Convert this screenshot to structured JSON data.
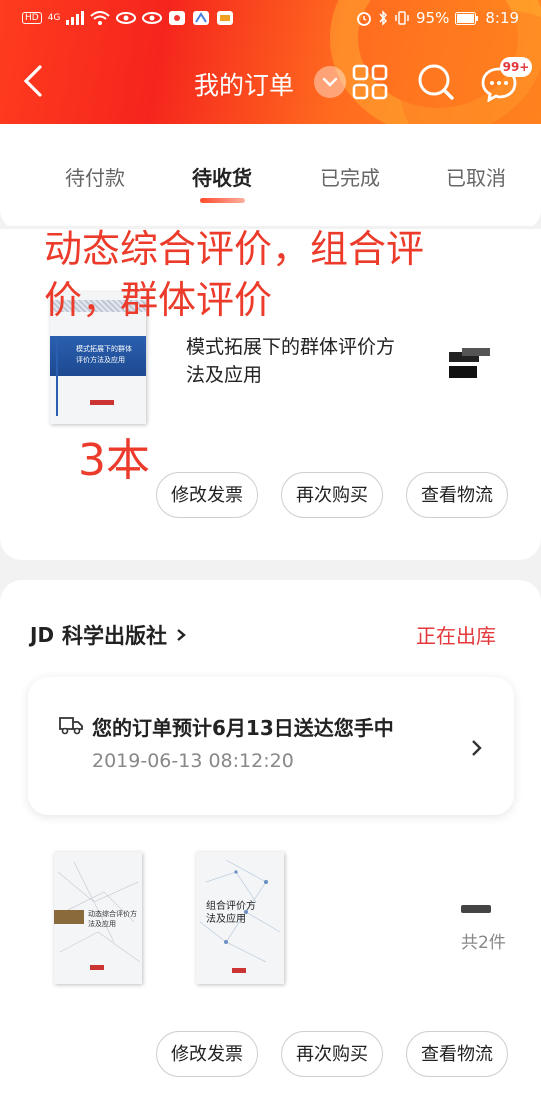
{
  "status_bar": {
    "left_labels": [
      "HD",
      "4G"
    ],
    "battery": "95%",
    "time": "8:19"
  },
  "nav": {
    "title": "我的订单",
    "message_badge": "99+"
  },
  "tabs": [
    {
      "label": "待付款"
    },
    {
      "label": "待收货"
    },
    {
      "label": "已完成"
    },
    {
      "label": "已取消"
    }
  ],
  "order1": {
    "product_title": "模式拓展下的群体评价方法及应用",
    "book_cover_title": "模式拓展下的群体评价方法及应用",
    "buttons": [
      "修改发票",
      "再次购买",
      "查看物流"
    ]
  },
  "annotations": {
    "top": "动态综合评价，组合评价，群体评价",
    "count": "3本"
  },
  "order2": {
    "shop_logo": "JD",
    "shop_name": "科学出版社",
    "status": "正在出库",
    "delivery_message": "您的订单预计6月13日送达您手中",
    "delivery_time": "2019-06-13 08:12:20",
    "book1_cover_title": "动态综合评价方法及应用",
    "book2_cover_title": "组合评价方法及应用",
    "total_count": "共2件",
    "buttons": [
      "修改发票",
      "再次购买",
      "查看物流"
    ]
  },
  "colors": {
    "brand_red": "#f5251d",
    "status_red": "#e4393c",
    "annotation_red": "#ec3b2b"
  }
}
